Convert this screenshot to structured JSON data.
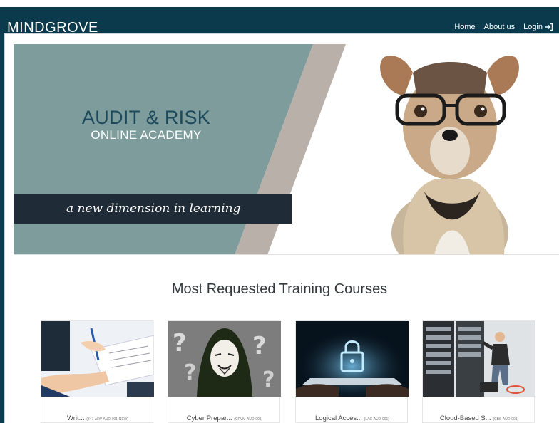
{
  "brand": "MINDGROVE",
  "nav": {
    "home": "Home",
    "about": "About us",
    "login": "Login"
  },
  "hero": {
    "title": "AUDIT & RISK",
    "subtitle": "ONLINE ACADEMY",
    "tagline": "a new dimension in learning"
  },
  "section_title": "Most Requested Training Courses",
  "courses": [
    {
      "name": "Writ...",
      "code": "(347-ARV-AUD-001-NEW)"
    },
    {
      "name": "Cyber Prepar...",
      "code": "(CPVM-AUD-001)"
    },
    {
      "name": "Logical Acces...",
      "code": "(LAC-AUD-001)"
    },
    {
      "name": "Cloud-Based S...",
      "code": "(CBS-AUD-001)"
    }
  ],
  "colors": {
    "navbar": "#0b3a4d",
    "hero_panel": "#7e9c9b",
    "hero_stripe": "#b9b0aa",
    "tagline_bar": "#1f2b36"
  }
}
